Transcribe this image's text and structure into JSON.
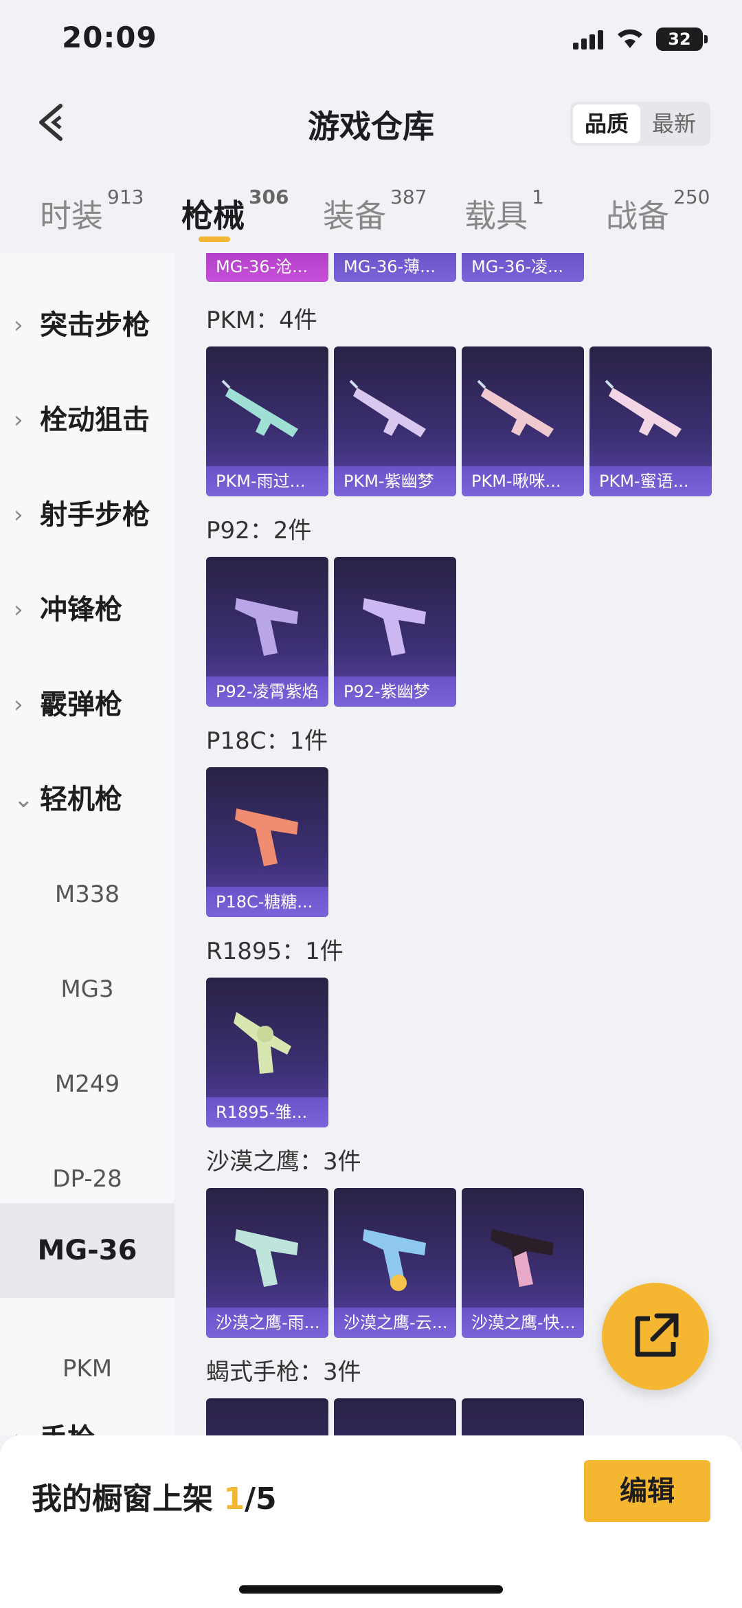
{
  "status": {
    "time": "20:09",
    "battery": "32"
  },
  "nav": {
    "title": "游戏仓库",
    "sort": [
      "品质",
      "最新"
    ]
  },
  "tabs": [
    {
      "label": "时装",
      "count": "913"
    },
    {
      "label": "枪械",
      "count": "306"
    },
    {
      "label": "装备",
      "count": "387"
    },
    {
      "label": "载具",
      "count": "1"
    },
    {
      "label": "战备",
      "count": "250"
    }
  ],
  "sidebar": {
    "categories": [
      "突击步枪",
      "栓动狙击",
      "射手步枪",
      "冲锋枪",
      "霰弹枪",
      "轻机枪",
      "手枪"
    ],
    "subs": [
      "M338",
      "MG3",
      "M249",
      "DP-28",
      "MG-36",
      "PKM"
    ]
  },
  "partial_row": [
    "MG-36-沧...",
    "MG-36-薄...",
    "MG-36-凌..."
  ],
  "groups": [
    {
      "title": "PKM：4件",
      "items": [
        "PKM-雨过...",
        "PKM-紫幽梦",
        "PKM-啾咪...",
        "PKM-蜜语..."
      ]
    },
    {
      "title": "P92：2件",
      "items": [
        "P92-凌霄紫焰",
        "P92-紫幽梦"
      ]
    },
    {
      "title": "P18C：1件",
      "items": [
        "P18C-糖糖..."
      ]
    },
    {
      "title": "R1895：1件",
      "items": [
        "R1895-雏..."
      ]
    },
    {
      "title": "沙漠之鹰：3件",
      "items": [
        "沙漠之鹰-雨...",
        "沙漠之鹰-云...",
        "沙漠之鹰-快..."
      ]
    },
    {
      "title": "蝎式手枪：3件",
      "items": [
        "",
        "",
        ""
      ]
    }
  ],
  "bottom": {
    "label": "我的橱窗上架",
    "count": "1",
    "total": "/5",
    "edit": "编辑"
  }
}
